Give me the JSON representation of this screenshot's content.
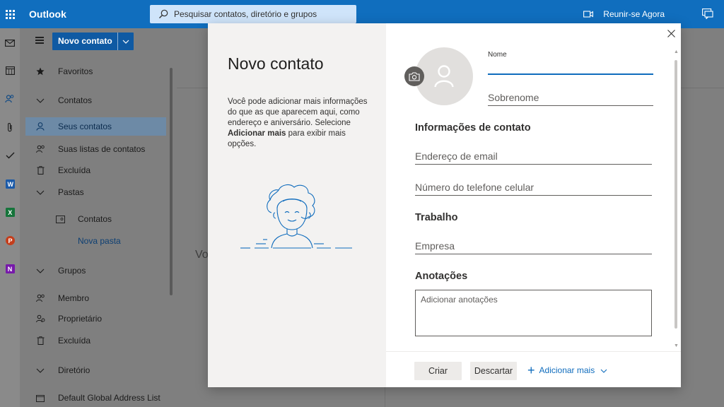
{
  "header": {
    "app_name": "Outlook",
    "search_placeholder": "Pesquisar contatos, diretório e grupos",
    "meet_label": "Reunir-se Agora",
    "brand_color": "#106ebe"
  },
  "rail": {
    "icons": [
      "mail-icon",
      "calendar-icon",
      "people-icon",
      "attachment-icon",
      "todo-icon",
      "word-icon",
      "excel-icon",
      "powerpoint-icon",
      "onenote-icon"
    ]
  },
  "toolbar": {
    "new_contact_label": "Novo contato"
  },
  "nav": {
    "favorites": "Favoritos",
    "contacts_header": "Contatos",
    "your_contacts": "Seus contatos",
    "contact_lists": "Suas listas de contatos",
    "deleted": "Excluída",
    "folders": "Pastas",
    "folder_contacts": "Contatos",
    "new_folder": "Nova pasta",
    "groups_header": "Grupos",
    "member": "Membro",
    "owner": "Proprietário",
    "groups_deleted": "Excluída",
    "directory_header": "Diretório",
    "global_list": "Default Global Address List"
  },
  "background": {
    "partial_text": "Vo"
  },
  "modal": {
    "title": "Novo contato",
    "desc_part1": "Você pode adicionar mais informações do que as que aparecem aqui, como endereço e aniversário. Selecione ",
    "desc_bold": "Adicionar mais",
    "desc_part2": " para exibir mais opções.",
    "first_name_label": "Nome",
    "first_name_value": "",
    "last_name_placeholder": "Sobrenome",
    "contact_info_title": "Informações de contato",
    "email_placeholder": "Endereço de email",
    "phone_placeholder": "Número do telefone celular",
    "work_title": "Trabalho",
    "company_placeholder": "Empresa",
    "notes_title": "Anotações",
    "notes_placeholder": "Adicionar anotações",
    "create_label": "Criar",
    "discard_label": "Descartar",
    "add_more_label": "Adicionar mais"
  }
}
